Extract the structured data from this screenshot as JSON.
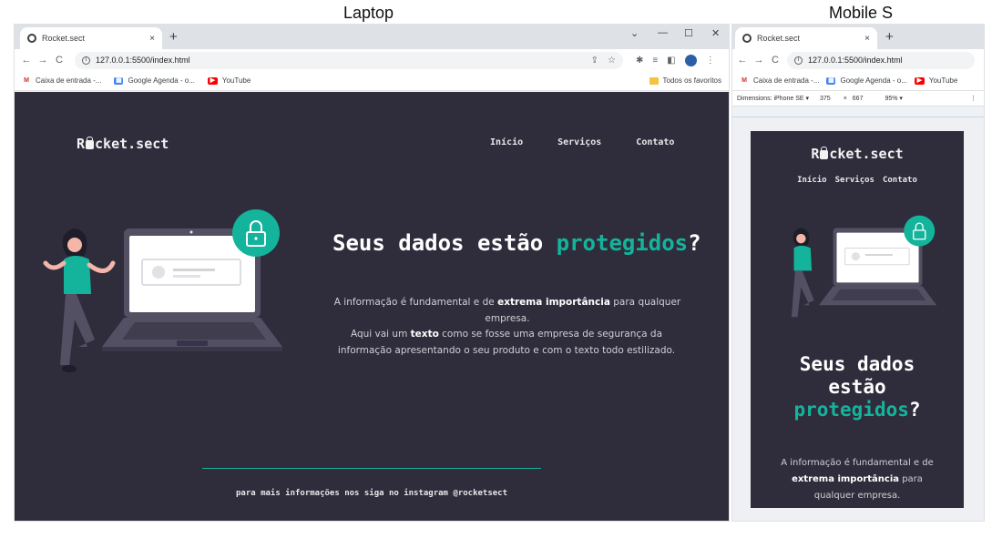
{
  "captions": {
    "laptop": "Laptop",
    "mobile": "Mobile S"
  },
  "browser": {
    "tab_title": "Rocket.sect",
    "tab_close": "×",
    "new_tab": "+",
    "url": "127.0.0.1:5500/index.html",
    "window_controls": {
      "dropdown": "⌄",
      "minimize": "—",
      "maximize": "☐",
      "close": "✕"
    },
    "nav": {
      "back": "←",
      "forward": "→",
      "reload": "C"
    },
    "bookmarks": [
      {
        "label": "Caixa de entrada -...",
        "icon": "gmail-icon"
      },
      {
        "label": "Google Agenda - o...",
        "icon": "calendar-icon"
      },
      {
        "label": "YouTube",
        "icon": "youtube-icon"
      }
    ],
    "all_bookmarks": "Todos os favoritos"
  },
  "devtools": {
    "dimensions_label": "Dimensions: iPhone SE ▾",
    "width": "375",
    "times": "×",
    "height": "667",
    "zoom": "95% ▾",
    "more": "⋮"
  },
  "site": {
    "logo_prefix": "R",
    "logo_suffix": "cket.sect",
    "nav": [
      "Início",
      "Serviços",
      "Contato"
    ],
    "title_main": "Seus dados estão ",
    "title_accent": "protegidos",
    "title_end": "?",
    "mobile_title_line1": "Seus dados",
    "mobile_title_line2": "estão",
    "p1_before": "A informação é fundamental e de ",
    "p1_bold": "extrema importância",
    "p1_after": " para qualquer empresa.",
    "p2_before": "Aqui vai um ",
    "p2_bold": "texto",
    "p2_after": " como se fosse uma empresa de segurança da informação apresentando o seu produto e com o texto todo estilizado.",
    "footer": "para mais informações nos siga no instagram @rocketsect"
  },
  "colors": {
    "background": "#2f2d3c",
    "accent": "#14b49c",
    "text": "#ffffff"
  }
}
